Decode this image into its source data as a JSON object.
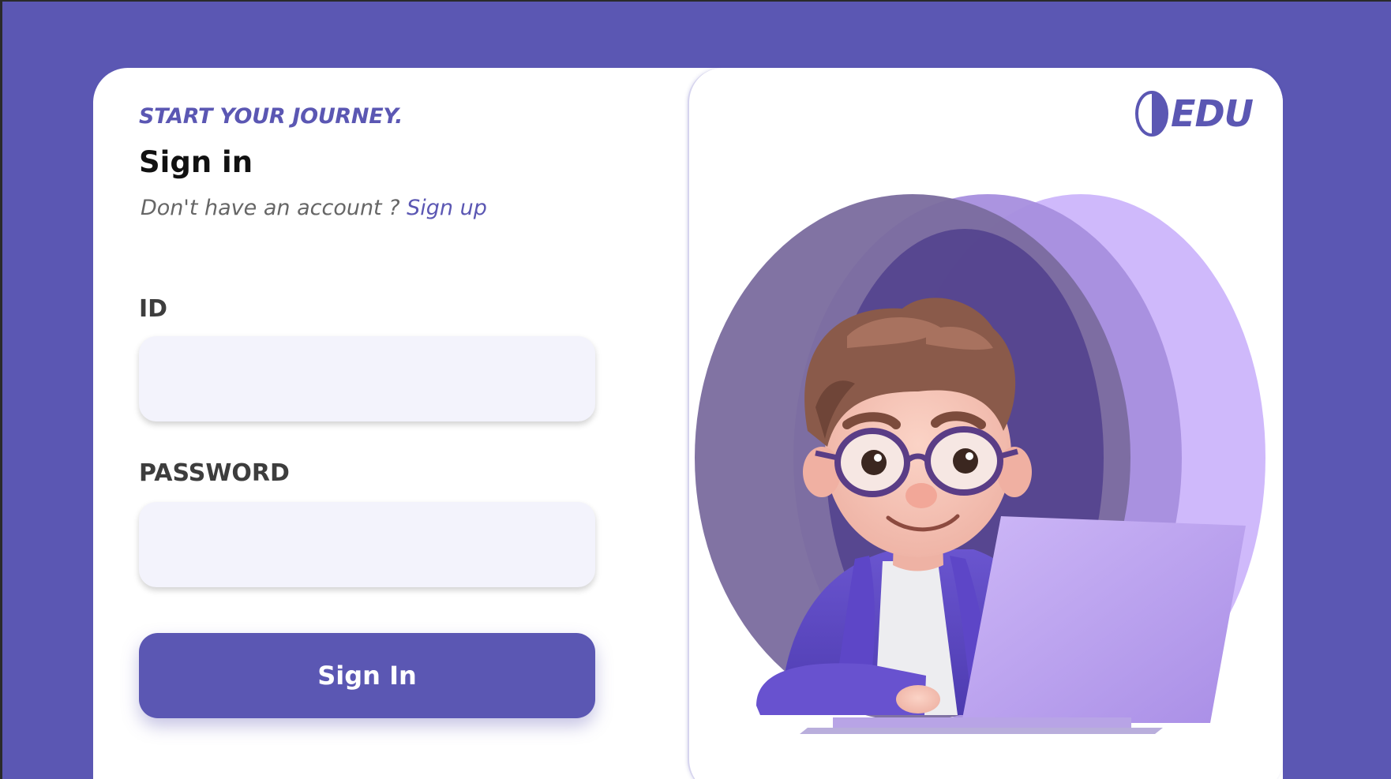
{
  "colors": {
    "brand": "#5b57b3",
    "background": "#5b57b3",
    "input_bg": "#f3f3fc",
    "text_dark": "#111111",
    "text_muted": "#666666"
  },
  "form": {
    "tagline": "START YOUR JOURNEY.",
    "title": "Sign in",
    "signup_prompt": "Don't have an account ?",
    "signup_link": "Sign up",
    "id_label": "ID",
    "id_value": "",
    "password_label": "PASSWORD",
    "password_value": "",
    "submit_label": "Sign In"
  },
  "brand": {
    "logo_text": "EDU",
    "logo_icon": "half-circle-logo-icon"
  },
  "illustration": {
    "icon": "student-with-laptop-illustration"
  }
}
